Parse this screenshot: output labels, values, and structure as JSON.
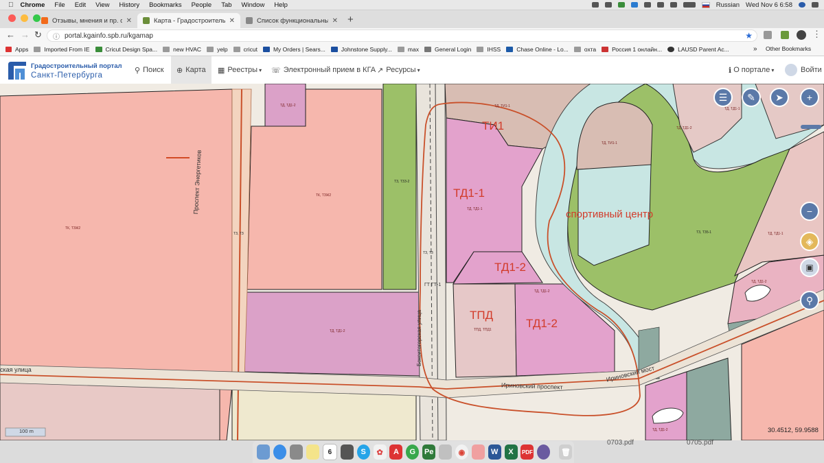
{
  "menubar": {
    "apple": "",
    "items": [
      "Chrome",
      "File",
      "Edit",
      "View",
      "History",
      "Bookmarks",
      "People",
      "Tab",
      "Window",
      "Help"
    ],
    "language": "Russian",
    "datetime": "Wed Nov 6  6:58"
  },
  "tabs": [
    {
      "title": "Отзывы, мнения и пр. о ЖК «",
      "fav_color": "#f26a1b",
      "active": false
    },
    {
      "title": "Карта - Градостроительный п",
      "fav_color": "#6b8e3a",
      "active": true
    },
    {
      "title": "Список функциональных зон",
      "fav_color": "#888888",
      "active": false
    }
  ],
  "address": {
    "url": "portal.kgainfo.spb.ru/kgamap"
  },
  "bookmarks": [
    "Apps",
    "Imported From IE",
    "Cricut Design Spa...",
    "new HVAC",
    "yelp",
    "cricut",
    "My Orders | Sears...",
    "Johnstone Supply...",
    "max",
    "General Login",
    "IHSS",
    "Chase Online - Lo...",
    "охта",
    "Россия 1 онлайн...",
    "LAUSD Parent Ac..."
  ],
  "bookmarks_more": "»",
  "bookmarks_other": "Other Bookmarks",
  "portal": {
    "logo_line1": "Градостроительный портал",
    "logo_line2": "Санкт-Петербурга",
    "nav": [
      "Поиск",
      "Карта",
      "Реестры",
      "Электронный прием в КГА",
      "Ресурсы"
    ],
    "about": "О портале",
    "login": "Войти"
  },
  "map": {
    "handwritten": {
      "ti1": "ТИ1",
      "td1_1": "ТД1-1",
      "td1_2a": "ТД1-2",
      "tpd": "ТПД",
      "td1_2b": "ТД1-2",
      "sport": "спортивный центр"
    },
    "small_labels": {
      "tk_ts2_left": "ТК, ТЗЖ2",
      "tk_ts2_mid": "ТК, ТЗЖ2",
      "td_td1": "ТД, ТД1-2",
      "tzh_vertical": "ТЗ, ТЗ",
      "tsp": "ТЗ, ТЗЗ-2",
      "ti_top": "ТД, ТИ1-1",
      "tdtd1": "ТД, ТД1-1",
      "td_mid": "ТД, ТД1-2",
      "tpd_small": "ТПД, ТПД1",
      "td_right": "ТД, ТД1-2",
      "ti_right": "ТД, ТИ1-1",
      "tr_right": "ТЗ, ТЗ5-1",
      "tt_top_left": "ТД, ТД1-2",
      "tt_top_right": "ТД, ТД1-1",
      "tt_right2": "ТД, ТД1-1",
      "tt_right3": "ТД, ТД1-2",
      "tt_bottom": "ТД, ТД1-2",
      "tt_tr": "ТЗ, ТЗ"
    },
    "streets": {
      "energetikov": "Проспект Энергетиков",
      "irinovsky": "Ириновский проспект",
      "irinovsky_bridge": "Ириновский мост",
      "bokitogorskaya": "Бокситогорская улица",
      "left_street": "ская улица",
      "tt_gray": "ГТ ГТ-1"
    },
    "scale": "100 m",
    "coords": "30.4512, 59.9588"
  },
  "desktop_files": [
    "0703.pdf",
    "0705.pdf"
  ],
  "dock_date": "6"
}
